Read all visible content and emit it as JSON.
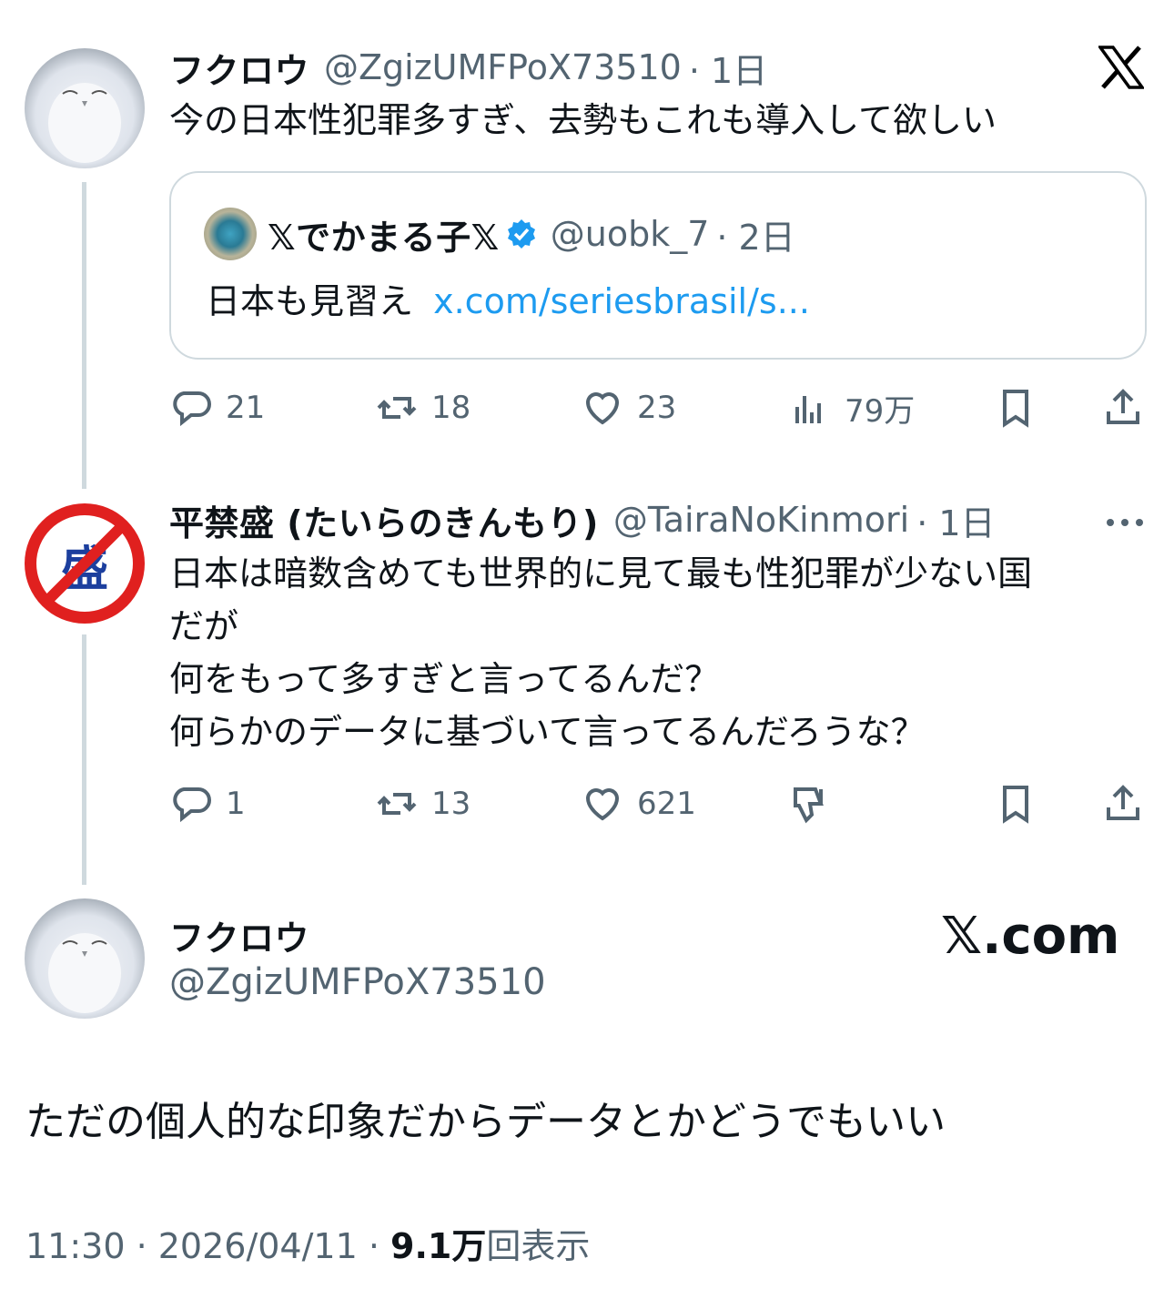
{
  "tweet1": {
    "author_name": "フクロウ",
    "author_handle": "@ZgizUMFPoX73510",
    "time": "· 1日",
    "text": "今の日本性犯罪多すぎ、去勢もこれも導入して欲しい",
    "quote": {
      "author_name": "𝕏でかまる子𝕏",
      "author_handle": "@uobk_7",
      "time": "· 2日",
      "text": "日本も見習え",
      "link": "x.com/seriesbrasil/s..."
    },
    "actions": {
      "replies": "21",
      "reposts": "18",
      "likes": "23",
      "views": "79万"
    }
  },
  "tweet2": {
    "author_name": "平禁盛 (たいらのきんもり)",
    "author_handle": "@TairaNoKinmori",
    "time": "· 1日",
    "avatar_glyph": "盛",
    "text_lines": [
      "日本は暗数含めても世界的に見て最も性犯罪が少ない国",
      "だが",
      "何をもって多すぎと言ってるんだ？",
      "何らかのデータに基づいて言ってるんだろうな？"
    ],
    "actions": {
      "replies": "1",
      "reposts": "13",
      "likes": "621"
    }
  },
  "tweet3": {
    "author_name": "フクロウ",
    "author_handle": "@ZgizUMFPoX73510",
    "brand": "𝕏.com",
    "text": "ただの個人的な印象だからデータとかどうでもいい",
    "timestamp": "11:30 · 2026/04/11 · ",
    "views_count": "9.1万",
    "views_label": "回表示"
  },
  "colors": {
    "accent": "#1d9bf0",
    "muted": "#536471",
    "text": "#0f1419",
    "border": "#cfd9de",
    "prohibit_red": "#e0201f"
  }
}
